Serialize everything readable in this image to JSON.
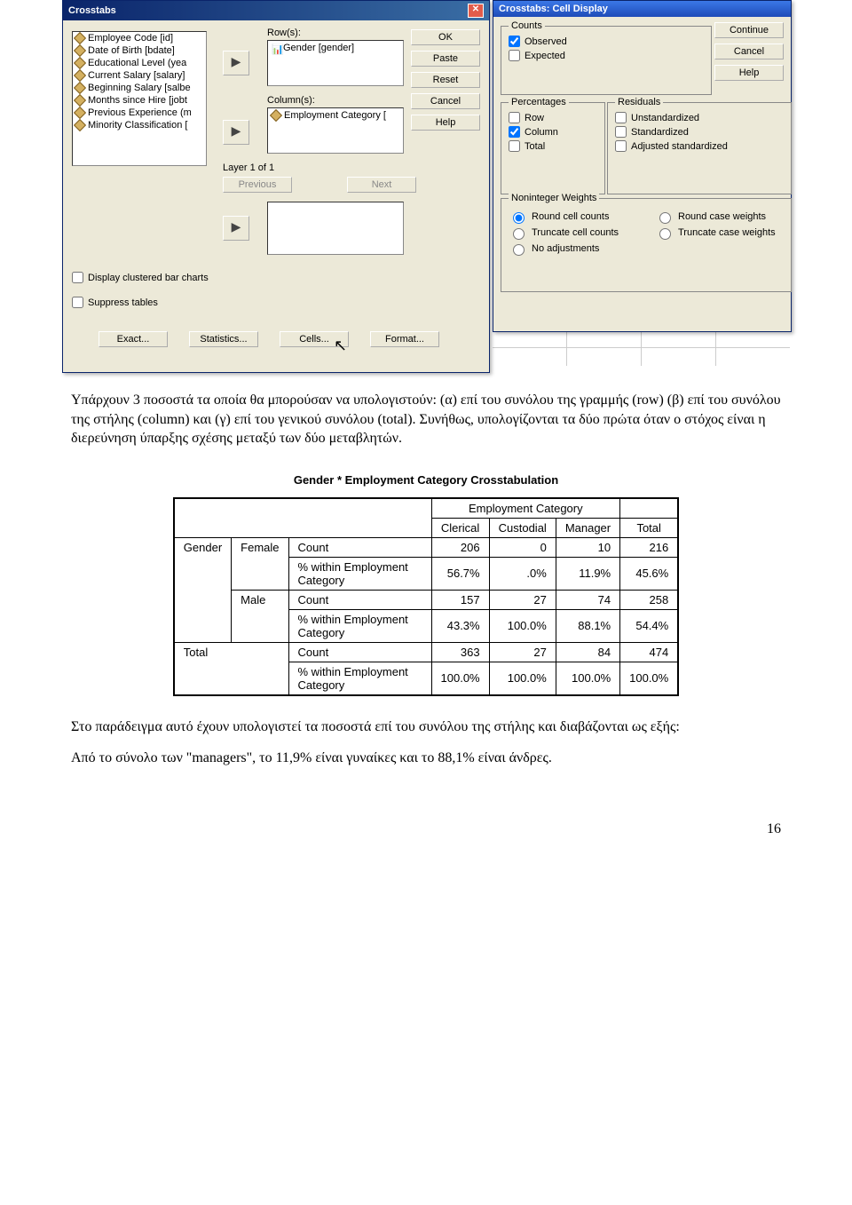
{
  "dialog1": {
    "title": "Crosstabs",
    "variables": [
      "Employee Code [id]",
      "Date of Birth [bdate]",
      "Educational Level (yea",
      "Current Salary [salary]",
      "Beginning Salary [salbe",
      "Months since Hire [jobt",
      "Previous Experience (m",
      "Minority Classification ["
    ],
    "rows_label": "Row(s):",
    "rows_item": "Gender [gender]",
    "cols_label": "Column(s):",
    "cols_item": "Employment Category [",
    "layer_label": "Layer 1 of 1",
    "previous": "Previous",
    "next": "Next",
    "display_clustered": "Display clustered bar charts",
    "suppress_tables": "Suppress tables",
    "bottom_buttons": [
      "Exact...",
      "Statistics...",
      "Cells...",
      "Format..."
    ],
    "side_buttons": [
      "OK",
      "Paste",
      "Reset",
      "Cancel",
      "Help"
    ]
  },
  "dialog2": {
    "title": "Crosstabs: Cell Display",
    "side_buttons": [
      "Continue",
      "Cancel",
      "Help"
    ],
    "counts_label": "Counts",
    "observed": "Observed",
    "expected": "Expected",
    "percentages_label": "Percentages",
    "row": "Row",
    "column": "Column",
    "total": "Total",
    "residuals_label": "Residuals",
    "unstd": "Unstandardized",
    "std": "Standardized",
    "adjstd": "Adjusted standardized",
    "nonint_label": "Noninteger Weights",
    "round_cell": "Round cell counts",
    "round_case": "Round case weights",
    "trunc_cell": "Truncate cell counts",
    "trunc_case": "Truncate case weights",
    "noadj": "No adjustments"
  },
  "paragraph1": "Υπάρχουν 3 ποσοστά τα οποία θα μπορούσαν να υπολογιστούν: (α) επί του συνόλου της γραμμής (row) (β) επί του συνόλου της στήλης (column) και (γ) επί του γενικού συνόλου (total). Συνήθως, υπολογίζονται τα δύο πρώτα όταν ο στόχος είναι η διερεύνηση ύπαρξης σχέσης μεταξύ των δύο μεταβλητών.",
  "table_title": "Gender * Employment Category Crosstabulation",
  "table": {
    "super_header": "Employment Category",
    "col_headers": [
      "Clerical",
      "Custodial",
      "Manager",
      "Total"
    ],
    "row_group": "Gender",
    "count_label": "Count",
    "pct_label": "% within Employment Category",
    "rows": [
      {
        "label": "Female",
        "count": [
          "206",
          "0",
          "10",
          "216"
        ],
        "pct": [
          "56.7%",
          ".0%",
          "11.9%",
          "45.6%"
        ]
      },
      {
        "label": "Male",
        "count": [
          "157",
          "27",
          "74",
          "258"
        ],
        "pct": [
          "43.3%",
          "100.0%",
          "88.1%",
          "54.4%"
        ]
      }
    ],
    "total": {
      "label": "Total",
      "count": [
        "363",
        "27",
        "84",
        "474"
      ],
      "pct": [
        "100.0%",
        "100.0%",
        "100.0%",
        "100.0%"
      ]
    }
  },
  "paragraph2": "Στο παράδειγμα αυτό έχουν υπολογιστεί τα ποσοστά επί του συνόλου της στήλης και διαβάζονται ως εξής:",
  "paragraph3": "Από το σύνολο των \"managers\", το 11,9% είναι γυναίκες και το 88,1% είναι άνδρες.",
  "page_number": "16"
}
